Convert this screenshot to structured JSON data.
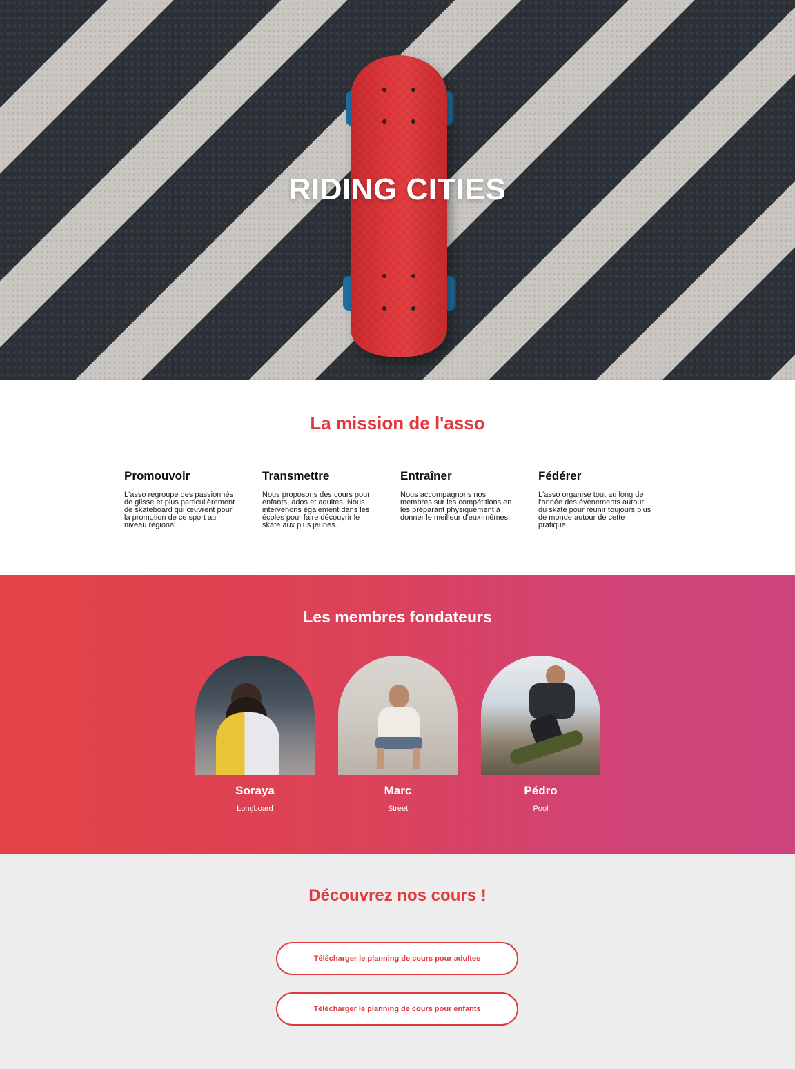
{
  "hero": {
    "title": "RIDING CITIES"
  },
  "mission": {
    "title": "La mission de l'asso",
    "items": [
      {
        "heading": "Promouvoir",
        "text": "L'asso regroupe des passionnés de glisse et plus particulièrement de skateboard qui œuvrent pour la promotion de ce sport au niveau régional."
      },
      {
        "heading": "Transmettre",
        "text": "Nous proposons des cours pour enfants, ados et adultes. Nous intervenons également dans les écoles pour faire découvrir le skate aux plus jeunes."
      },
      {
        "heading": "Entraîner",
        "text": "Nous accompagnons nos membres sur les compétitions en les préparant physiquement à donner le meilleur d'eux-mêmes."
      },
      {
        "heading": "Fédérer",
        "text": "L'asso organise tout au long de l'année des évènements autour du skate pour réunir toujours plus de monde autour de cette pratique."
      }
    ]
  },
  "members": {
    "title": "Les membres fondateurs",
    "list": [
      {
        "name": "Soraya",
        "discipline": "Longboard"
      },
      {
        "name": "Marc",
        "discipline": "Street"
      },
      {
        "name": "Pédro",
        "discipline": "Pool"
      }
    ]
  },
  "courses": {
    "title": "Découvrez nos cours !",
    "button_adults": "Télécharger le planning de cours pour adultes",
    "button_children": "Télécharger le planning de cours pour enfants"
  },
  "colors": {
    "accent_red": "#e0393d",
    "gradient_start": "#e24345",
    "gradient_end": "#cc447b",
    "courses_bg": "#ededed"
  }
}
